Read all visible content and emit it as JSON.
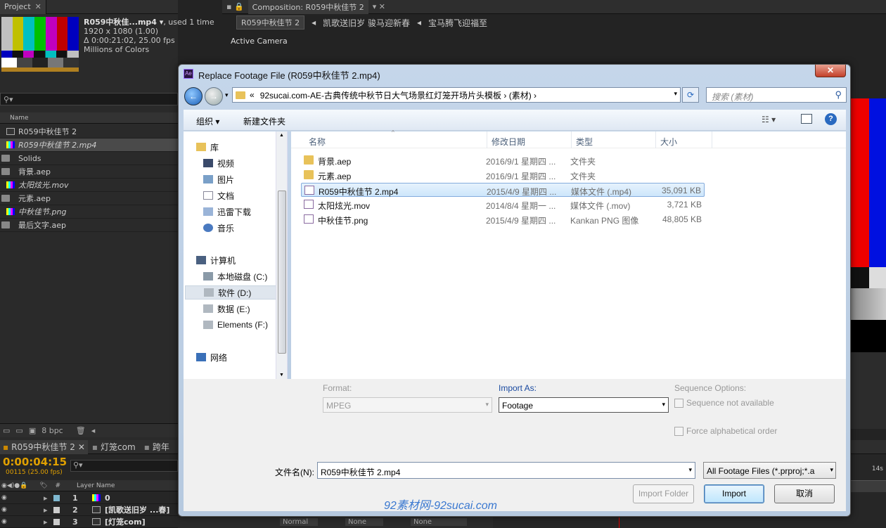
{
  "project": {
    "tab": "Project",
    "item": {
      "name": "R059中秋佳...mp4 ▾",
      "used": ", used 1 time",
      "res": "1920 x 1080 (1.00)",
      "dur": "Δ 0:00:21:02, 25.00 fps",
      "colors": "Millions of Colors"
    },
    "col_name": "Name",
    "items": [
      {
        "label": "R059中秋佳节 2",
        "italic": false,
        "icon": "composition-icon"
      },
      {
        "label": "R059中秋佳节 2.mp4",
        "italic": true,
        "icon": "footage-icon"
      },
      {
        "label": "Solids",
        "italic": false,
        "icon": "folder-icon"
      },
      {
        "label": "背景.aep",
        "italic": false,
        "icon": "folder-icon"
      },
      {
        "label": "太阳炫光.mov",
        "italic": true,
        "icon": "footage-icon"
      },
      {
        "label": "元素.aep",
        "italic": false,
        "icon": "folder-icon"
      },
      {
        "label": "中秋佳节.png",
        "italic": true,
        "icon": "footage-icon"
      },
      {
        "label": "最后文字.aep",
        "italic": false,
        "icon": "folder-icon"
      }
    ],
    "bpc": "8 bpc"
  },
  "composition": {
    "tab": "Composition: R059中秋佳节 2",
    "breadcrumbs": [
      "R059中秋佳节 2",
      "凯歌送旧岁 骏马迎新春",
      "宝马腾飞迎福至"
    ],
    "camera": "Active Camera"
  },
  "timeline": {
    "tabs": [
      "R059中秋佳节 2",
      "灯笼com",
      "跨年"
    ],
    "timecode": "0:00:04:15",
    "frames": "00115 (25.00 fps)",
    "col_layer": "Layer Name",
    "layers": [
      {
        "num": "1",
        "name": "0"
      },
      {
        "num": "2",
        "name": "[凯歌送旧岁 ...春]"
      },
      {
        "num": "3",
        "name": "[灯笼com]"
      }
    ],
    "mode1": "Normal",
    "mode2": "None",
    "mode3": "None",
    "ruler_label": "14s"
  },
  "dialog": {
    "title": "Replace Footage File (R059中秋佳节 2.mp4)",
    "address": "92sucai.com-AE-古典传统中秋节日大气场景红灯笼开场片头模板  ›  (素材)  ›",
    "address_prefix": "«",
    "search_placeholder": "搜索 (素材)",
    "toolbar": {
      "organize": "组织 ▾",
      "new_folder": "新建文件夹"
    },
    "nav": [
      {
        "label": "库",
        "icon": "library-icon",
        "group": true
      },
      {
        "label": "视频",
        "icon": "video-icon",
        "group": false
      },
      {
        "label": "图片",
        "icon": "picture-icon",
        "group": false
      },
      {
        "label": "文档",
        "icon": "document-icon",
        "group": false
      },
      {
        "label": "迅雷下载",
        "icon": "download-icon",
        "group": false
      },
      {
        "label": "音乐",
        "icon": "music-icon",
        "group": false
      },
      {
        "label": "计算机",
        "icon": "computer-icon",
        "group": true
      },
      {
        "label": "本地磁盘 (C:)",
        "icon": "drive-c-icon",
        "group": false
      },
      {
        "label": "软件 (D:)",
        "icon": "drive-d-icon",
        "group": false
      },
      {
        "label": "数据 (E:)",
        "icon": "drive-e-icon",
        "group": false
      },
      {
        "label": "Elements (F:)",
        "icon": "drive-f-icon",
        "group": false
      },
      {
        "label": "网络",
        "icon": "network-icon",
        "group": true
      }
    ],
    "columns": {
      "name": "名称",
      "date": "修改日期",
      "type": "类型",
      "size": "大小"
    },
    "files": [
      {
        "name": "背景.aep",
        "date": "2016/9/1 星期四 ...",
        "type": "文件夹",
        "size": "",
        "kind": "folder"
      },
      {
        "name": "元素.aep",
        "date": "2016/9/1 星期四 ...",
        "type": "文件夹",
        "size": "",
        "kind": "folder"
      },
      {
        "name": "R059中秋佳节 2.mp4",
        "date": "2015/4/9 星期四 ...",
        "type": "媒体文件 (.mp4)",
        "size": "35,091 KB",
        "kind": "mp4"
      },
      {
        "name": "太阳炫光.mov",
        "date": "2014/8/4 星期一 ...",
        "type": "媒体文件 (.mov)",
        "size": "3,721 KB",
        "kind": "mov"
      },
      {
        "name": "中秋佳节.png",
        "date": "2015/4/9 星期四 ...",
        "type": "Kankan PNG 图像",
        "size": "48,805 KB",
        "kind": "png"
      }
    ],
    "format_label": "Format:",
    "format_value": "MPEG",
    "import_as_label": "Import As:",
    "import_as_value": "Footage",
    "sequence_label": "Sequence Options:",
    "sequence_check": "Sequence not available",
    "force_check": "Force alphabetical order",
    "filename_label": "文件名(N):",
    "filename_value": "R059中秋佳节 2.mp4",
    "filter": "All Footage Files (*.prproj;*.a",
    "import_folder": "Import Folder",
    "import": "Import",
    "cancel": "取消",
    "watermark": "92素材网-92sucai.com"
  }
}
